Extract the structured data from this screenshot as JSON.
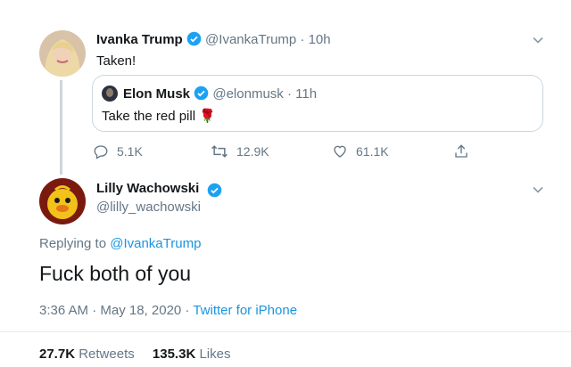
{
  "tweet1": {
    "name": "Ivanka Trump",
    "handle": "@IvankaTrump",
    "time": "· 10h",
    "text": "Taken!",
    "quote": {
      "name": "Elon Musk",
      "handle": "@elonmusk",
      "time": "· 11h",
      "text": "Take the red pill",
      "emoji": "🌹"
    },
    "actions": {
      "replies": "5.1K",
      "retweets": "12.9K",
      "likes": "61.1K"
    }
  },
  "tweet2": {
    "name": "Lilly Wachowski",
    "handle": "@lilly_wachowski",
    "replying_prefix": "Replying to",
    "replying_to": "@IvankaTrump",
    "text": "Fuck both of you",
    "timestamp": "3:36 AM · May 18, 2020 ·",
    "source": "Twitter for iPhone",
    "retweets_count": "27.7K",
    "retweets_label": "Retweets",
    "likes_count": "135.3K",
    "likes_label": "Likes"
  },
  "colors": {
    "link": "#1b95e0",
    "verified": "#1da1f2",
    "muted": "#657786"
  }
}
